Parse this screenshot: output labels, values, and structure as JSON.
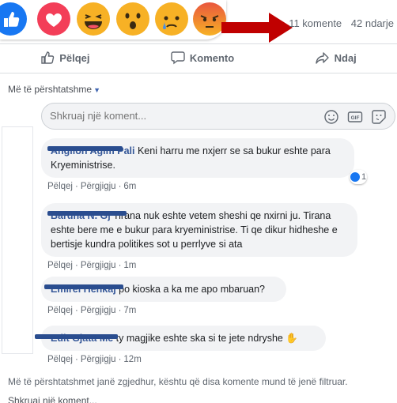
{
  "counts": {
    "comments": "11 komente",
    "shares": "42 ndarje"
  },
  "actions": {
    "like": "Pëlqej",
    "comment": "Komento",
    "share": "Ndaj"
  },
  "sort_label": "Më të përshtatshme",
  "composer": {
    "placeholder": "Shkruaj një koment..."
  },
  "comments": [
    {
      "author": "Anglion Agim Pali",
      "text": "Keni harru me nxjerr se sa bukur eshte para Kryeministrise.",
      "like": "Pëlqej",
      "reply": "Përgjigju",
      "time": "6m",
      "reaction_count": "1"
    },
    {
      "author": "Bardha N. Gj",
      "text": "Tirana nuk eshte vetem sheshi qe nxirni ju. Tirana eshte bere me e bukur para kryeministrise. Ti qe dikur hidheshe e bertisje kundra politikes sot u perrlyve si ata",
      "like": "Pëlqej",
      "reply": "Përgjigju",
      "time": "1m"
    },
    {
      "author": "Emirel Henkaj",
      "text": "po kioska a ka me apo mbaruan?",
      "like": "Pëlqej",
      "reply": "Përgjigju",
      "time": "7m"
    },
    {
      "author": "Edit Gjata Me",
      "text": "ty magjike eshte ska si te jete ndryshe",
      "like": "Pëlqej",
      "reply": "Përgjigju",
      "time": "12m"
    }
  ],
  "footer_note": "Më të përshtatshmet janë zgjedhur, kështu që disa komente mund të jenë filtruar.",
  "footer_write": "Shkruaj një koment..."
}
